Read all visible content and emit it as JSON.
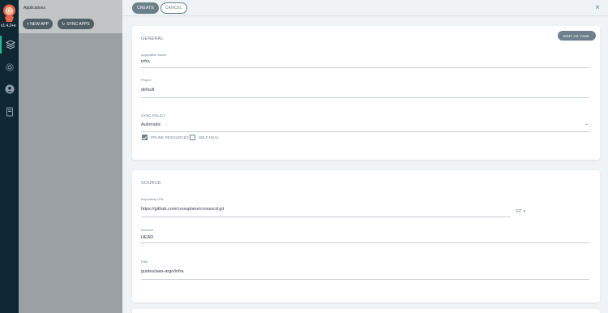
{
  "nav": {
    "version": "v1.4.2+e",
    "items": [
      {
        "name": "applications",
        "icon": "layers-icon",
        "active": true
      },
      {
        "name": "settings",
        "icon": "gear-icon",
        "active": false
      },
      {
        "name": "user-info",
        "icon": "user-icon",
        "active": false
      },
      {
        "name": "documentation",
        "icon": "book-icon",
        "active": false
      }
    ]
  },
  "background_page": {
    "title": "Applications",
    "new_app_label": "+ NEW APP",
    "sync_apps_label": "SYNC APPS"
  },
  "panel": {
    "create_label": "CREATE",
    "cancel_label": "CANCEL",
    "close_glyph": "×",
    "edit_yaml_label": "EDIT AS YAML",
    "general": {
      "heading": "GENERAL",
      "app_name_label": "Application Name",
      "app_name_value": "infra",
      "project_label": "Project",
      "project_value": "default",
      "sync_policy_label": "SYNC POLICY",
      "sync_policy_value": "Automatic",
      "prune_label": "PRUNE RESOURCES",
      "prune_checked": true,
      "self_heal_label": "SELF HEAL",
      "self_heal_checked": false
    },
    "source": {
      "heading": "SOURCE",
      "repo_label": "Repository URL",
      "repo_value": "https://github.com/crossplane/crossxcd.git",
      "repo_type": "GIT",
      "revision_label": "Revision",
      "revision_value": "HEAD",
      "revision_hint": "ⓘ",
      "path_label": "Path",
      "path_value": "guides/aws-argo/infra"
    }
  },
  "colors": {
    "nav_bg": "#0f2733",
    "accent": "#18be94",
    "button": "#6d7f8b",
    "panel_bg": "#eff3f5"
  }
}
